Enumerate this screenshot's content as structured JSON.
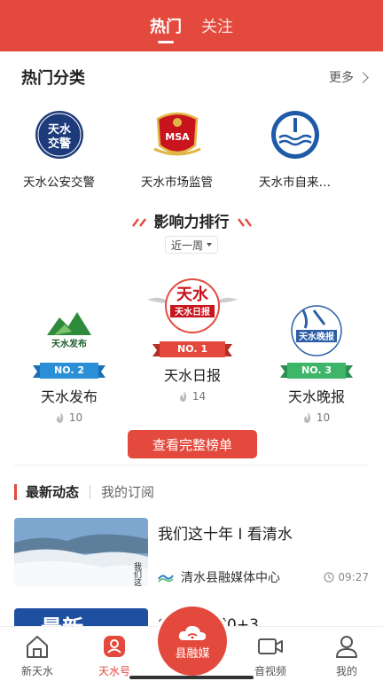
{
  "header": {
    "tabs": [
      {
        "label": "热门"
      },
      {
        "label": "关注"
      }
    ]
  },
  "hot_categories": {
    "title": "热门分类",
    "more_label": "更多",
    "items": [
      {
        "label": "天水公安交警",
        "logo_text": "天水交警"
      },
      {
        "label": "天水市场监管",
        "logo_text": "MSA"
      },
      {
        "label": "天水市自来…",
        "logo_text": "天水市自来水公司"
      }
    ]
  },
  "ranking": {
    "title": "影响力排行",
    "period": "近一周",
    "items": [
      {
        "rank_label": "NO. 2",
        "name": "天水发布",
        "count": "10",
        "logo_text": "天水发布",
        "color": "#2a8fd6"
      },
      {
        "rank_label": "NO. 1",
        "name": "天水日报",
        "count": "14",
        "logo_text": "天水日报",
        "color": "#e34a3d"
      },
      {
        "rank_label": "NO. 3",
        "name": "天水晚报",
        "count": "10",
        "logo_text": "天水晚报",
        "color": "#3fb56a"
      }
    ],
    "full_list_button": "查看完整榜单"
  },
  "news": {
    "tabs": [
      {
        "label": "最新动态"
      },
      {
        "label": "我的订阅"
      }
    ],
    "items": [
      {
        "title": "我们这十年 I 看清水",
        "source": "清水县融媒体中心",
        "time": "09:27",
        "thumb_text": "我们这十年"
      },
      {
        "title": "85… 甘肃0+3",
        "source": "",
        "time": "",
        "thumb_text": "最新"
      }
    ]
  },
  "bottom_nav": {
    "items": [
      {
        "label": "新天水"
      },
      {
        "label": "天水号"
      },
      {
        "label": "音视频"
      },
      {
        "label": "我的"
      }
    ],
    "center_label": "县融媒"
  },
  "colors": {
    "brand_red": "#e34a3d",
    "rank_blue": "#2a8fd6",
    "rank_green": "#3fb56a"
  }
}
